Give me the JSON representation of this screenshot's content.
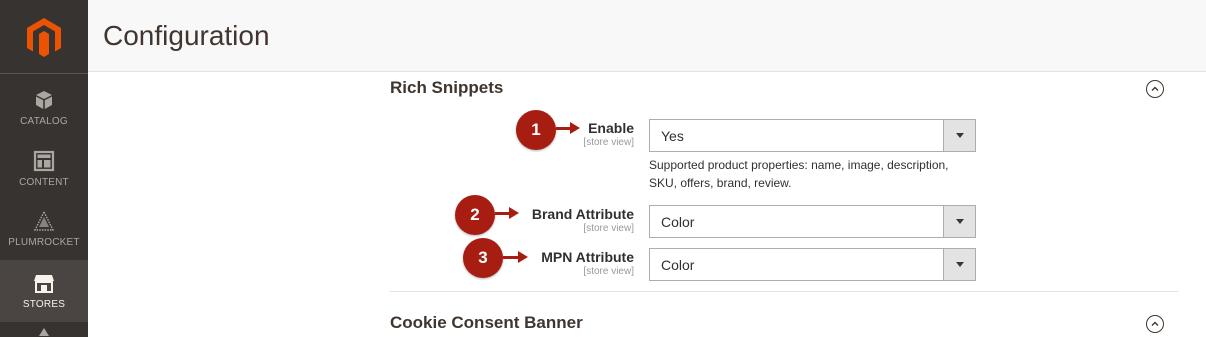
{
  "header": {
    "title": "Configuration"
  },
  "sidebar": {
    "items": [
      {
        "label": "CATALOG",
        "icon": "cube-icon"
      },
      {
        "label": "CONTENT",
        "icon": "layout-icon"
      },
      {
        "label": "PLUMROCKET",
        "icon": "plumrocket-icon"
      },
      {
        "label": "STORES",
        "icon": "store-icon",
        "active": true
      }
    ]
  },
  "sections": [
    {
      "title": "Rich Snippets",
      "expanded": true
    },
    {
      "title": "Cookie Consent Banner",
      "expanded": false
    }
  ],
  "fields": [
    {
      "label": "Enable",
      "scope": "[store view]",
      "value": "Yes",
      "callout": "1"
    },
    {
      "label": "Brand Attribute",
      "scope": "[store view]",
      "value": "Color",
      "callout": "2"
    },
    {
      "label": "MPN Attribute",
      "scope": "[store view]",
      "value": "Color",
      "callout": "3"
    }
  ],
  "enable_note": "Supported product properties: name, image, description, SKU, offers, brand, review.",
  "colors": {
    "sidebar": "#373330",
    "accent": "#eb5202",
    "callout": "#a71d12"
  }
}
